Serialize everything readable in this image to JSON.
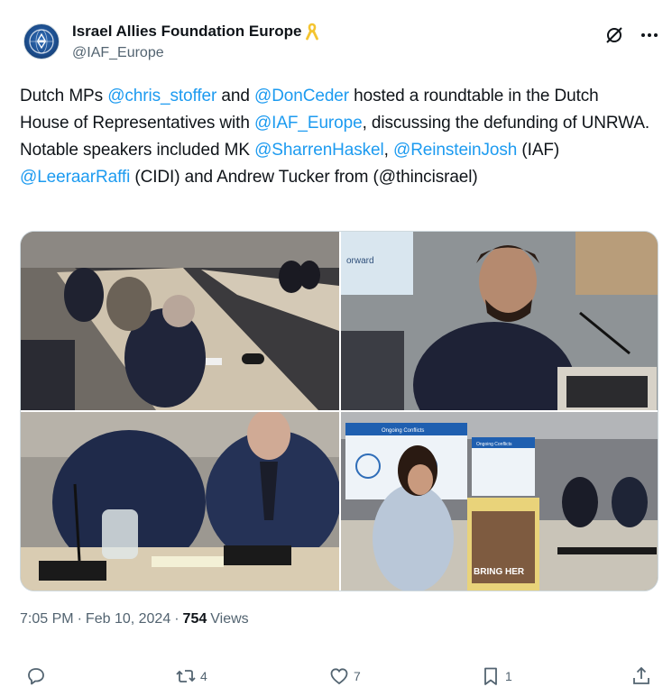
{
  "author": {
    "display_name": "Israel Allies Foundation Europe",
    "handle": "@IAF_Europe",
    "badge_icon": "yellow-ribbon-icon"
  },
  "tweet": {
    "segments": [
      {
        "text": "Dutch MPs ",
        "mention": false
      },
      {
        "text": "@chris_stoffer",
        "mention": true
      },
      {
        "text": " and ",
        "mention": false
      },
      {
        "text": "@DonCeder",
        "mention": true
      },
      {
        "text": " hosted a roundtable in the Dutch House of Representatives with ",
        "mention": false
      },
      {
        "text": "@IAF_Europe",
        "mention": true
      },
      {
        "text": ", discussing the defunding of UNRWA. Notable speakers included MK ",
        "mention": false
      },
      {
        "text": "@SharrenHaskel",
        "mention": true
      },
      {
        "text": ", ",
        "mention": false
      },
      {
        "text": "@ReinsteinJosh",
        "mention": true
      },
      {
        "text": " (IAF) ",
        "mention": false
      },
      {
        "text": "@LeeraarRaffi",
        "mention": true
      },
      {
        "text": " (CIDI)  and Andrew Tucker from (@thincisrael)",
        "mention": false
      }
    ]
  },
  "media": {
    "photos": [
      {
        "name": "roundtable-room-photo"
      },
      {
        "name": "speaker-with-microphone-photo",
        "screen_text": "orward"
      },
      {
        "name": "two-men-at-table-photo"
      },
      {
        "name": "presentation-ongoing-conflicts-photo",
        "screen_text": "Ongoing Conflicts",
        "screen_text_2": "Ongoing Conflicts",
        "poster_text": "BRING HER"
      }
    ]
  },
  "meta": {
    "time": "7:05 PM",
    "separator": "·",
    "date": "Feb 10, 2024",
    "views_count": "754",
    "views_label": "Views"
  },
  "actions": {
    "reply": {
      "icon": "reply-icon",
      "count": ""
    },
    "repost": {
      "icon": "repost-icon",
      "count": "4"
    },
    "like": {
      "icon": "heart-icon",
      "count": "7"
    },
    "bookmark": {
      "icon": "bookmark-icon",
      "count": "1"
    },
    "share": {
      "icon": "share-icon",
      "count": ""
    }
  },
  "colors": {
    "accent": "#1d9bf0",
    "text": "#0f1419",
    "muted": "#536471",
    "ribbon": "#f4c430"
  }
}
